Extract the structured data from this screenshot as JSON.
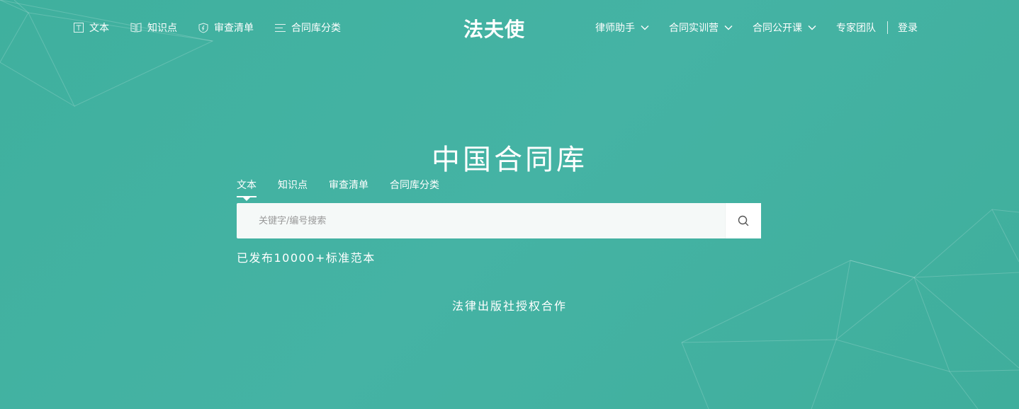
{
  "nav_left": [
    {
      "icon": "text-icon",
      "label": "文本"
    },
    {
      "icon": "book-icon",
      "label": "知识点"
    },
    {
      "icon": "shield-icon",
      "label": "审查清单"
    },
    {
      "icon": "list-icon",
      "label": "合同库分类"
    }
  ],
  "logo": "法夫使",
  "nav_right": {
    "lawyer_assistant": "律师助手",
    "contract_camp": "合同实训营",
    "open_course": "合同公开课",
    "expert_team": "专家团队",
    "login": "登录"
  },
  "hero": {
    "title": "中国合同库"
  },
  "search": {
    "tabs": [
      "文本",
      "知识点",
      "审查清单",
      "合同库分类"
    ],
    "active_tab": "文本",
    "placeholder": "关键字/编号搜索",
    "button_icon": "search-icon"
  },
  "published_text": "已发布10000+标准范本",
  "cooperation_text": "法律出版社授权合作",
  "colors": {
    "background": "#43b2a2",
    "search_bg": "#f5f9f8",
    "text": "#ffffff"
  }
}
